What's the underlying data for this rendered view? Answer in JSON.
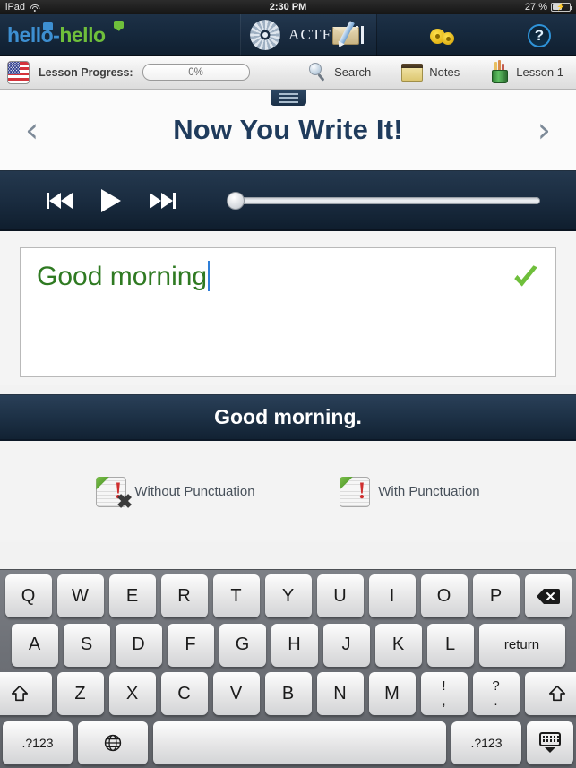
{
  "status_bar": {
    "device": "iPad",
    "wifi_icon": "wifi-icon",
    "time": "2:30 PM",
    "battery_percent": "27 %",
    "battery_icon": "battery-charging-icon"
  },
  "app_bar": {
    "logo": {
      "first": "hello",
      "dash": "-",
      "second": "hello"
    },
    "actfl": {
      "label": "ACTFL",
      "logo_icon": "actfl-mandala-icon",
      "bars_icon": "three-bars-icon"
    },
    "icons": [
      {
        "name": "mail-pencil-icon",
        "title": "Mail"
      },
      {
        "name": "gears-icon",
        "title": "Settings"
      },
      {
        "name": "help-question-icon",
        "title": "Help",
        "glyph": "?"
      }
    ]
  },
  "sub_bar": {
    "flag_icon": "us-flag-icon",
    "progress_label": "Lesson Progress:",
    "progress_value": "0%",
    "tools": [
      {
        "name": "search",
        "label": "Search",
        "icon": "magnifier-icon"
      },
      {
        "name": "notes",
        "label": "Notes",
        "icon": "notepad-icon"
      },
      {
        "name": "lesson",
        "label": "Lesson 1",
        "icon": "pencil-cup-icon"
      }
    ]
  },
  "title_band": {
    "handle_icon": "drawer-handle-icon",
    "prev_icon": "‹",
    "title": "Now You Write It!",
    "next_icon": "›"
  },
  "player": {
    "prev_label": "previous-track",
    "play_label": "play",
    "next_label": "next-track",
    "progress_position": 0
  },
  "answer": {
    "typed_text": "Good morning",
    "correct_icon": "green-check-icon",
    "solution_text": "Good morning."
  },
  "punctuation": {
    "options": [
      {
        "name": "without-punctuation",
        "label": "Without Punctuation",
        "icon": "card-exclamation-x-icon"
      },
      {
        "name": "with-punctuation",
        "label": "With Punctuation",
        "icon": "card-exclamation-icon"
      }
    ]
  },
  "keyboard": {
    "row1": [
      "Q",
      "W",
      "E",
      "R",
      "T",
      "Y",
      "U",
      "I",
      "O",
      "P"
    ],
    "backspace_icon": "backspace-icon",
    "row2": [
      "A",
      "S",
      "D",
      "F",
      "G",
      "H",
      "J",
      "K",
      "L"
    ],
    "return_label": "return",
    "shift_icon": "shift-icon",
    "row3": [
      "Z",
      "X",
      "C",
      "V",
      "B",
      "N",
      "M"
    ],
    "dual_keys": [
      {
        "top": "!",
        "bottom": ","
      },
      {
        "top": "?",
        "bottom": "."
      }
    ],
    "numeric_label": ".?123",
    "globe_icon": "globe-icon",
    "space_label": "space",
    "hide_icon": "hide-keyboard-icon"
  },
  "colors": {
    "brand_blue": "#3d8fd1",
    "brand_green": "#6fbf3b",
    "title_navy": "#1f3b5c",
    "answer_green": "#2f7a22",
    "caret_blue": "#2f7fd8",
    "check_green": "#6fbf3b"
  }
}
